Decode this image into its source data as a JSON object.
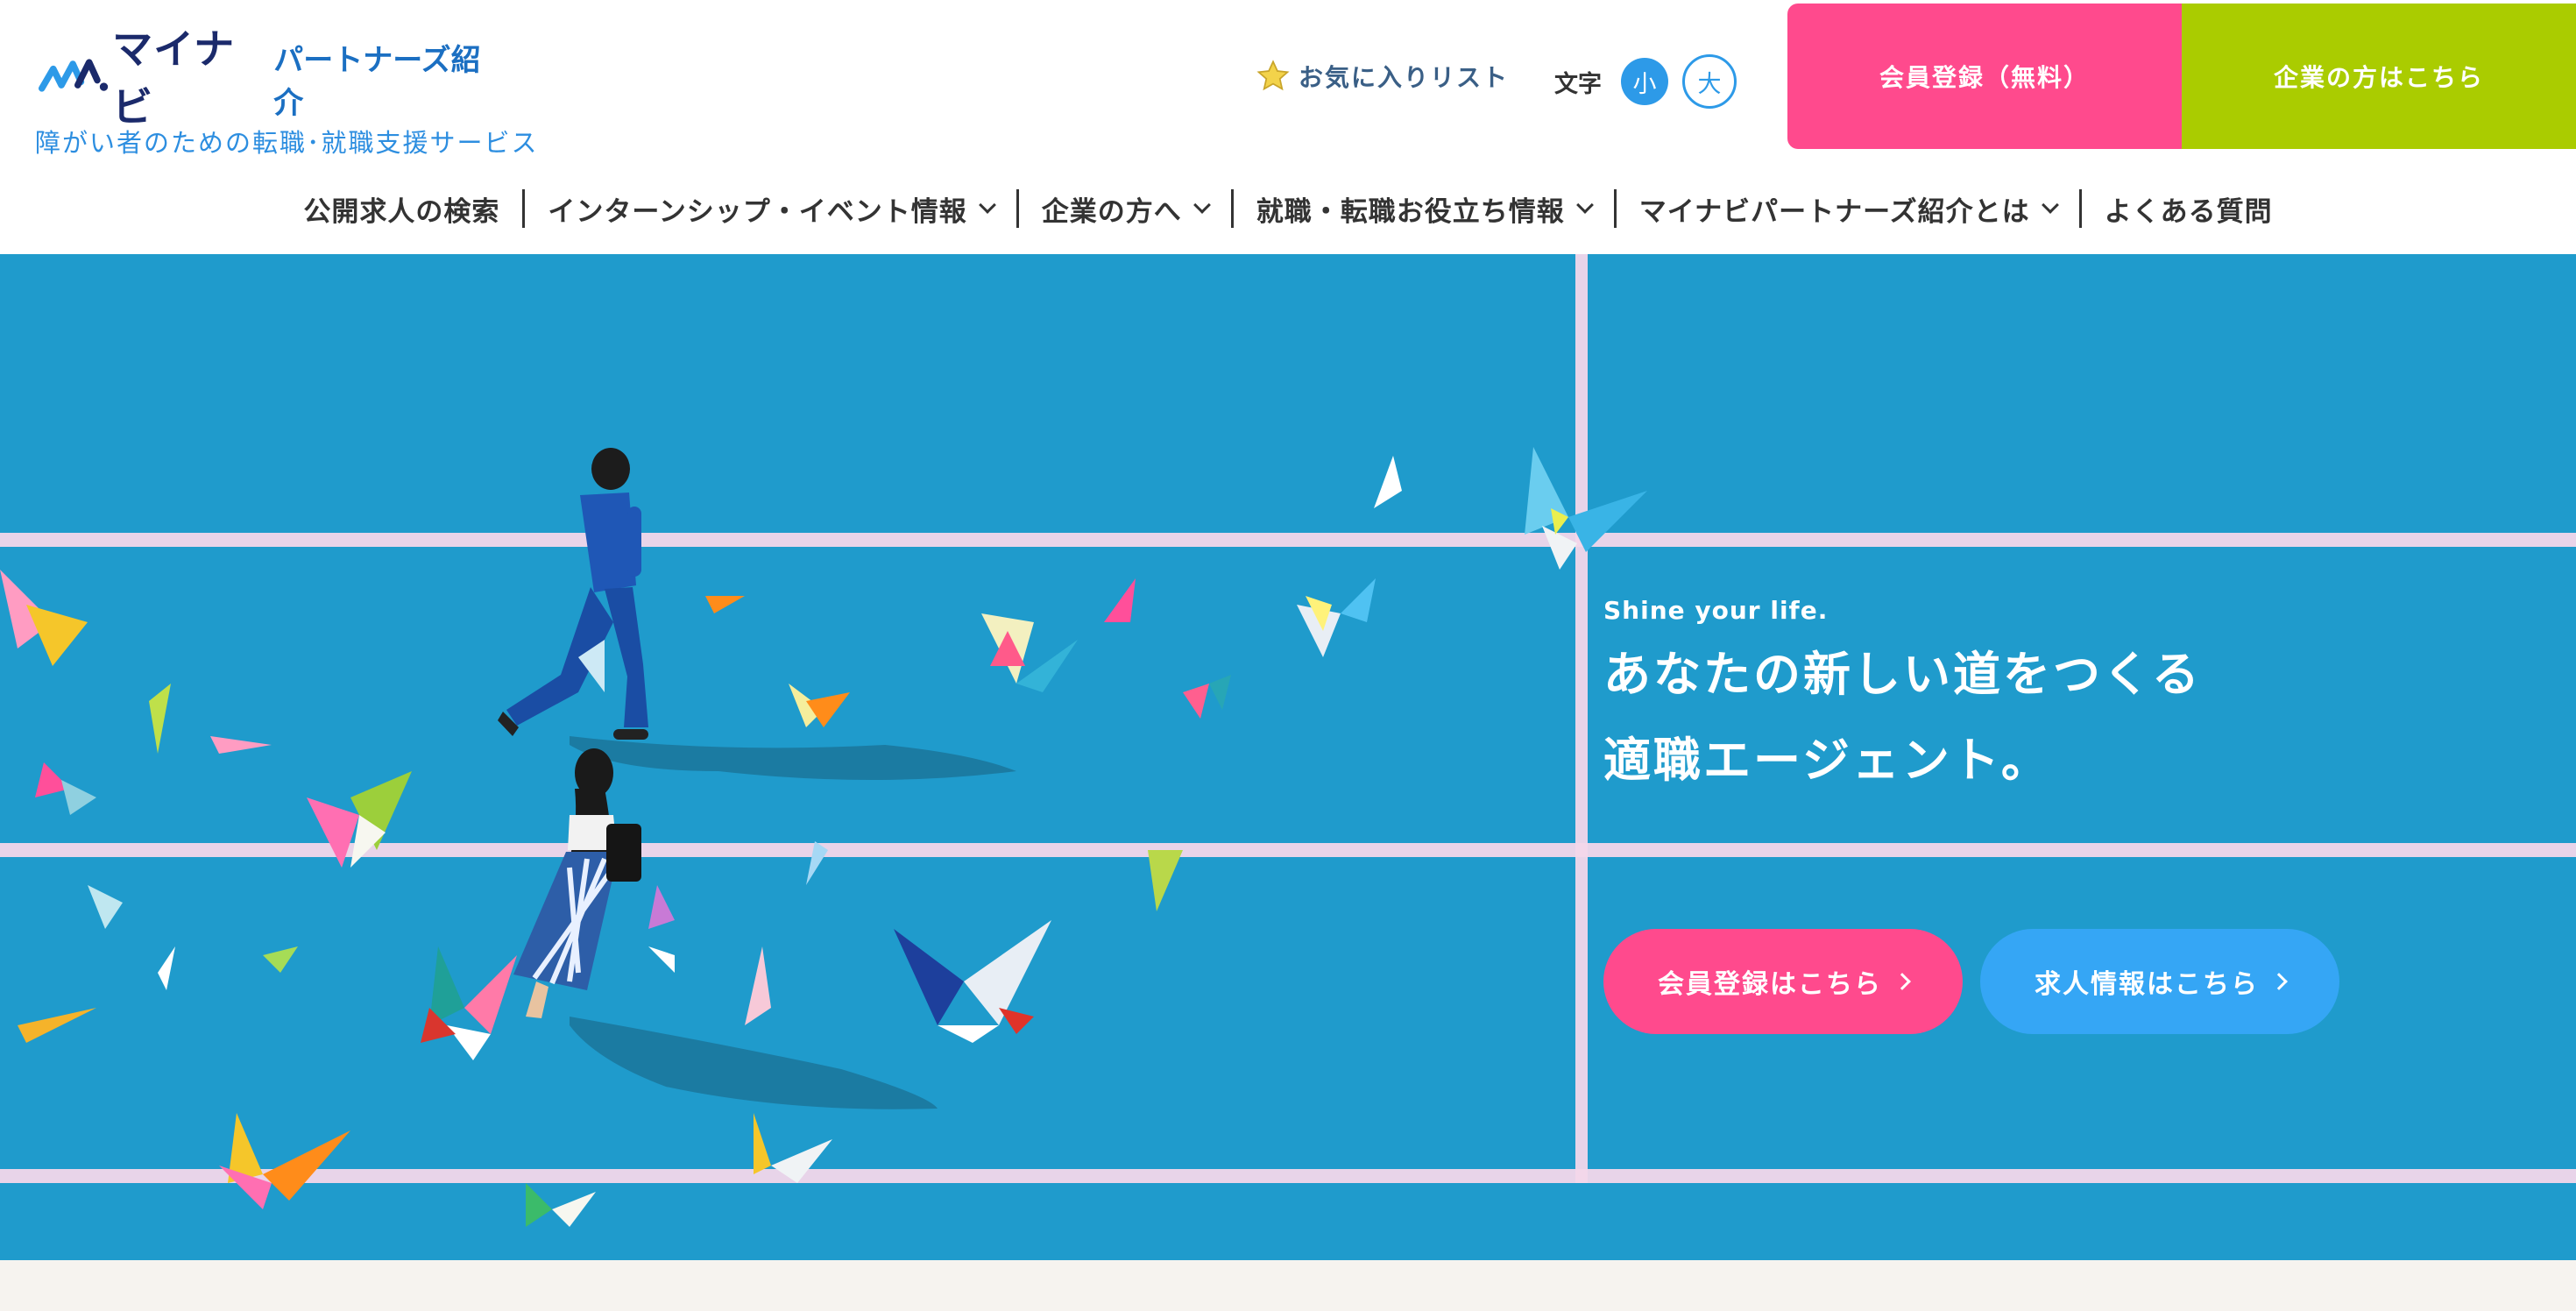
{
  "header": {
    "logo_main": "マイナビ",
    "logo_sub": "パートナーズ紹介",
    "tagline": "障がい者のための転職･就職支援サービス",
    "favorites_label": "お気に入りリスト",
    "font_size_label": "文字",
    "font_small": "小",
    "font_large": "大",
    "cta_member": "会員登録（無料）",
    "cta_company": "企業の方はこちら"
  },
  "nav": {
    "items": [
      {
        "label": "公開求人の検索",
        "dropdown": false
      },
      {
        "label": "インターンシップ・イベント情報",
        "dropdown": true
      },
      {
        "label": "企業の方へ",
        "dropdown": true
      },
      {
        "label": "就職・転職お役立ち情報",
        "dropdown": true
      },
      {
        "label": "マイナビパートナーズ紹介とは",
        "dropdown": true
      },
      {
        "label": "よくある質問",
        "dropdown": false
      }
    ]
  },
  "hero": {
    "tagline_en": "Shine your life.",
    "headline_line1": "あなたの新しい道をつくる",
    "headline_line2": "適職エージェント。",
    "button_member": "会員登録はこちら",
    "button_jobs": "求人情報はこちら"
  },
  "colors": {
    "brand_navy": "#1b2a6b",
    "brand_blue": "#2d8ee0",
    "pink": "#ff4a8d",
    "lime": "#aacc00",
    "hero_bg": "#1f9bcc",
    "light_blue_button": "#35a6f5"
  },
  "icons": {
    "favorites": "star-icon",
    "dropdown": "chevron-down-icon",
    "button_arrow": "chevron-right-icon"
  }
}
